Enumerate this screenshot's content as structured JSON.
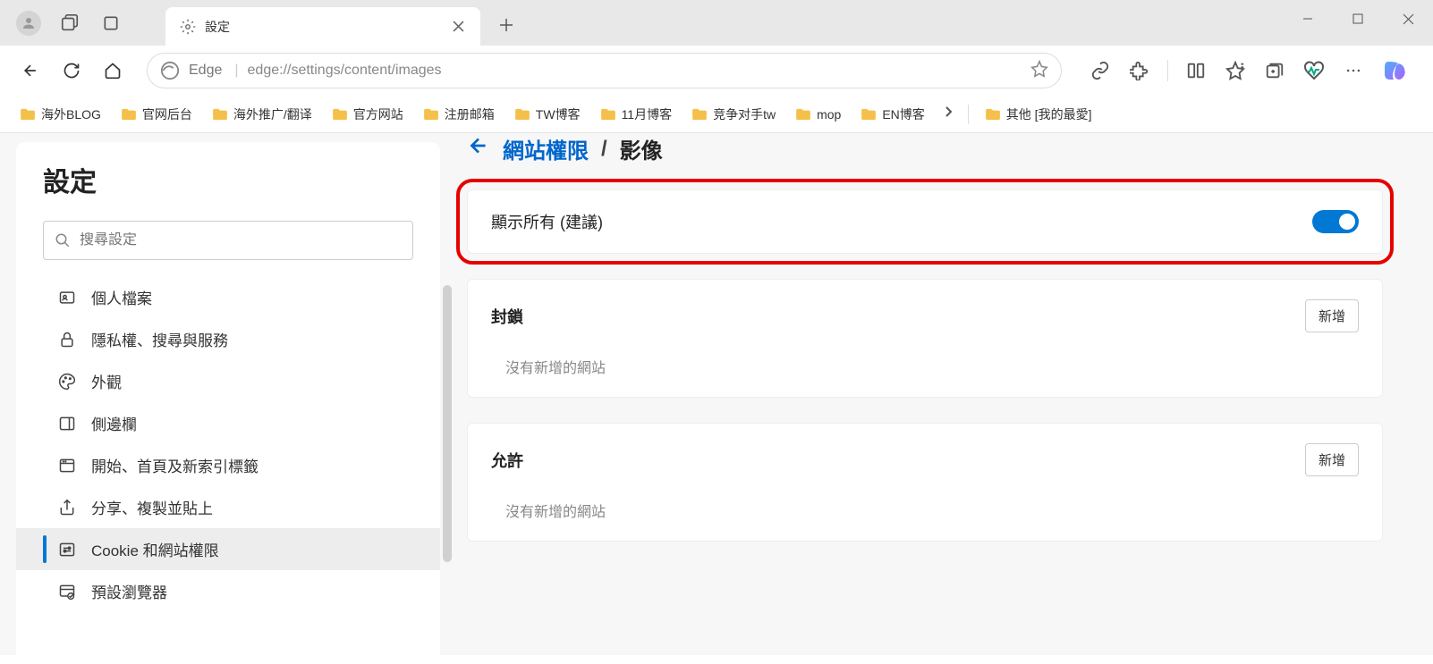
{
  "tab": {
    "title": "設定"
  },
  "address": {
    "browser": "Edge",
    "url": "edge://settings/content/images"
  },
  "bookmarks": {
    "items": [
      "海外BLOG",
      "官网后台",
      "海外推广/翻译",
      "官方网站",
      "注册邮箱",
      "TW博客",
      "11月博客",
      "竞争对手tw",
      "mop",
      "EN博客"
    ],
    "other": "其他 [我的最愛]"
  },
  "sidebar": {
    "title": "設定",
    "search_placeholder": "搜尋設定",
    "items": [
      "個人檔案",
      "隱私權、搜尋與服務",
      "外觀",
      "側邊欄",
      "開始、首頁及新索引標籤",
      "分享、複製並貼上",
      "Cookie 和網站權限",
      "預設瀏覽器"
    ]
  },
  "breadcrumb": {
    "parent": "網站權限",
    "current": "影像"
  },
  "main": {
    "show_all": "顯示所有 (建議)",
    "block": {
      "title": "封鎖",
      "add": "新增",
      "empty": "沒有新增的網站"
    },
    "allow": {
      "title": "允許",
      "add": "新增",
      "empty": "沒有新增的網站"
    }
  }
}
